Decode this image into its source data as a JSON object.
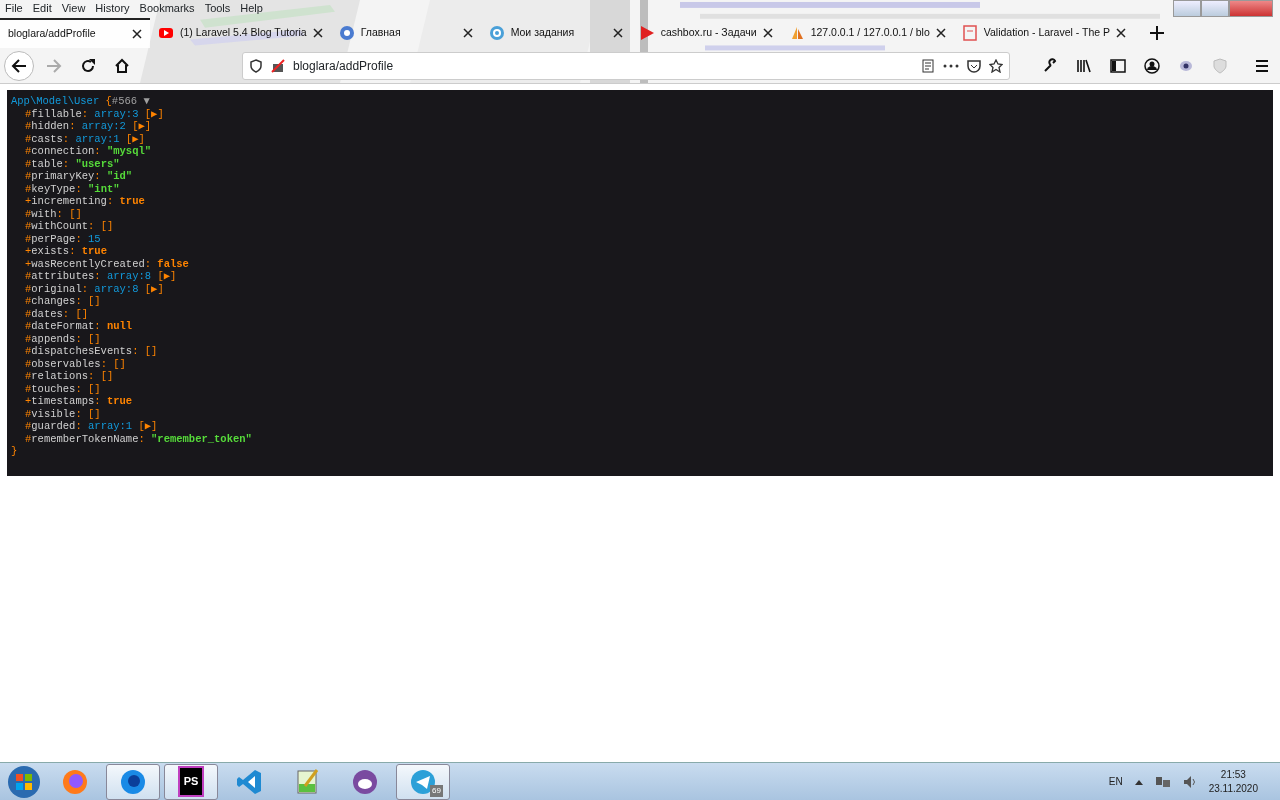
{
  "menu_bar": [
    "File",
    "Edit",
    "View",
    "History",
    "Bookmarks",
    "Tools",
    "Help"
  ],
  "tabs": [
    {
      "title": "bloglara/addProfile",
      "kind": "plain",
      "selected": true
    },
    {
      "title": "(1) Laravel 5.4 Blog Tutoria",
      "kind": "video",
      "selected": false
    },
    {
      "title": "Главная",
      "kind": "globe",
      "selected": false
    },
    {
      "title": "Мои задания",
      "kind": "target",
      "selected": false
    },
    {
      "title": "cashbox.ru - Задачи",
      "kind": "flag",
      "selected": false
    },
    {
      "title": "127.0.0.1 / 127.0.0.1 / blo",
      "kind": "sail",
      "selected": false
    },
    {
      "title": "Validation - Laravel - The P",
      "kind": "doc",
      "selected": false
    }
  ],
  "navigation": {
    "back_disabled": false,
    "forward_disabled": true
  },
  "address_bar": {
    "url": "bloglara/addProfile"
  },
  "dump": {
    "class": "App\\Model\\User",
    "brace_open": "{",
    "ref": "#566",
    "toggle": "▼",
    "brace_close": "}",
    "properties": [
      {
        "prefix": "#",
        "name": "fillable",
        "separator": ":",
        "kind": "array",
        "value": "array:3",
        "expander": "[▶]"
      },
      {
        "prefix": "#",
        "name": "hidden",
        "separator": ":",
        "kind": "array",
        "value": "array:2",
        "expander": "[▶]"
      },
      {
        "prefix": "#",
        "name": "casts",
        "separator": ":",
        "kind": "array",
        "value": "array:1",
        "expander": "[▶]"
      },
      {
        "prefix": "#",
        "name": "connection",
        "separator": ":",
        "kind": "string",
        "value": "\"mysql\""
      },
      {
        "prefix": "#",
        "name": "table",
        "separator": ":",
        "kind": "string",
        "value": "\"users\""
      },
      {
        "prefix": "#",
        "name": "primaryKey",
        "separator": ":",
        "kind": "string",
        "value": "\"id\""
      },
      {
        "prefix": "#",
        "name": "keyType",
        "separator": ":",
        "kind": "string",
        "value": "\"int\""
      },
      {
        "prefix": "+",
        "name": "incrementing",
        "separator": ":",
        "kind": "constant",
        "value": "true"
      },
      {
        "prefix": "#",
        "name": "with",
        "separator": ":",
        "kind": "empty",
        "value": "[]"
      },
      {
        "prefix": "#",
        "name": "withCount",
        "separator": ":",
        "kind": "empty",
        "value": "[]"
      },
      {
        "prefix": "#",
        "name": "perPage",
        "separator": ":",
        "kind": "number",
        "value": "15"
      },
      {
        "prefix": "+",
        "name": "exists",
        "separator": ":",
        "kind": "constant",
        "value": "true"
      },
      {
        "prefix": "+",
        "name": "wasRecentlyCreated",
        "separator": ":",
        "kind": "constant",
        "value": "false"
      },
      {
        "prefix": "#",
        "name": "attributes",
        "separator": ":",
        "kind": "array",
        "value": "array:8",
        "expander": "[▶]"
      },
      {
        "prefix": "#",
        "name": "original",
        "separator": ":",
        "kind": "array",
        "value": "array:8",
        "expander": "[▶]"
      },
      {
        "prefix": "#",
        "name": "changes",
        "separator": ":",
        "kind": "empty",
        "value": "[]"
      },
      {
        "prefix": "#",
        "name": "dates",
        "separator": ":",
        "kind": "empty",
        "value": "[]"
      },
      {
        "prefix": "#",
        "name": "dateFormat",
        "separator": ":",
        "kind": "constant",
        "value": "null"
      },
      {
        "prefix": "#",
        "name": "appends",
        "separator": ":",
        "kind": "empty",
        "value": "[]"
      },
      {
        "prefix": "#",
        "name": "dispatchesEvents",
        "separator": ":",
        "kind": "empty",
        "value": "[]"
      },
      {
        "prefix": "#",
        "name": "observables",
        "separator": ":",
        "kind": "empty",
        "value": "[]"
      },
      {
        "prefix": "#",
        "name": "relations",
        "separator": ":",
        "kind": "empty",
        "value": "[]"
      },
      {
        "prefix": "#",
        "name": "touches",
        "separator": ":",
        "kind": "empty",
        "value": "[]"
      },
      {
        "prefix": "+",
        "name": "timestamps",
        "separator": ":",
        "kind": "constant",
        "value": "true"
      },
      {
        "prefix": "#",
        "name": "visible",
        "separator": ":",
        "kind": "empty",
        "value": "[]"
      },
      {
        "prefix": "#",
        "name": "guarded",
        "separator": ":",
        "kind": "array",
        "value": "array:1",
        "expander": "[▶]"
      },
      {
        "prefix": "#",
        "name": "rememberTokenName",
        "separator": ":",
        "kind": "string",
        "value": "\"remember_token\""
      }
    ]
  },
  "taskbar": {
    "apps": [
      {
        "kind": "firefox",
        "active": false
      },
      {
        "kind": "firefox-dev",
        "active": true
      },
      {
        "kind": "ps",
        "label": "PS",
        "active": true
      },
      {
        "kind": "code",
        "active": false
      },
      {
        "kind": "notepad",
        "active": false
      },
      {
        "kind": "cat",
        "active": false
      },
      {
        "kind": "telegram",
        "badge": "69",
        "active": true
      }
    ],
    "language": "EN",
    "time": "21:53",
    "date": "23.11.2020"
  }
}
